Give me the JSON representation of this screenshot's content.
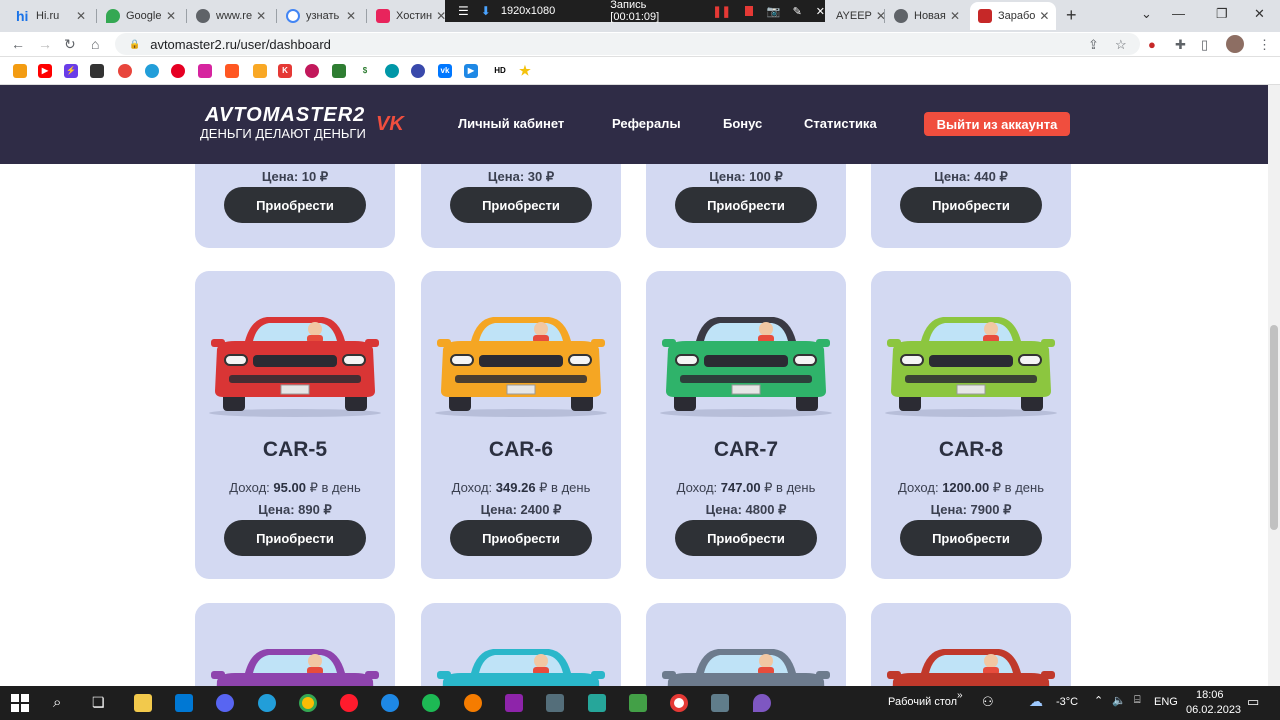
{
  "browser": {
    "tabs": [
      {
        "title": "Hi.ru",
        "color": "#1a73e8"
      },
      {
        "title": "Google",
        "color": "#34a853"
      },
      {
        "title": "www.re",
        "color": "#5f6368"
      },
      {
        "title": "узнать",
        "color": "#4285f4"
      },
      {
        "title": "Хостин",
        "color": "#e8245c"
      },
      {
        "title": "AYEEP",
        "color": "#888888"
      },
      {
        "title": "Новая",
        "color": "#5f6368"
      },
      {
        "title": "Зарабо",
        "color": "#c62828"
      }
    ],
    "url": "avtomaster2.ru/user/dashboard",
    "recorder": {
      "resolution": "1920x1080",
      "status": "Запись [00:01:09]"
    },
    "bookmarks_extra": "HD"
  },
  "site": {
    "logo_title": "AVTOMASTER2",
    "logo_subtitle": "ДЕНЬГИ ДЕЛАЮТ ДЕНЬГИ",
    "nav": [
      "Личный кабинет",
      "Рефералы",
      "Бонус",
      "Статистика"
    ],
    "logout": "Выйти из аккаунта",
    "income_label": "Доход:",
    "income_suffix": "₽ в день",
    "price_label": "Цена:",
    "currency": "₽",
    "buy_label": "Приобрести",
    "top_prices": [
      "10",
      "30",
      "100",
      "440"
    ],
    "cars": [
      {
        "name": "CAR-5",
        "income": "95.00",
        "price": "890",
        "color": "#d93535",
        "kind": "red"
      },
      {
        "name": "CAR-6",
        "income": "349.26",
        "price": "2400",
        "color": "#f5a623",
        "kind": "yellow"
      },
      {
        "name": "CAR-7",
        "income": "747.00",
        "price": "4800",
        "color": "#2fb36a",
        "kind": "green"
      },
      {
        "name": "CAR-8",
        "income": "1200.00",
        "price": "7900",
        "color": "#8cc63f",
        "kind": "lime"
      }
    ],
    "bottom_colors": [
      "#8e44ad",
      "#2ab7ca",
      "#6d7b8d",
      "#c0392b"
    ]
  },
  "taskbar": {
    "desktop_label": "Рабочий стол",
    "temperature": "-3°C",
    "lang": "ENG",
    "time": "18:06",
    "date": "06.02.2023"
  }
}
